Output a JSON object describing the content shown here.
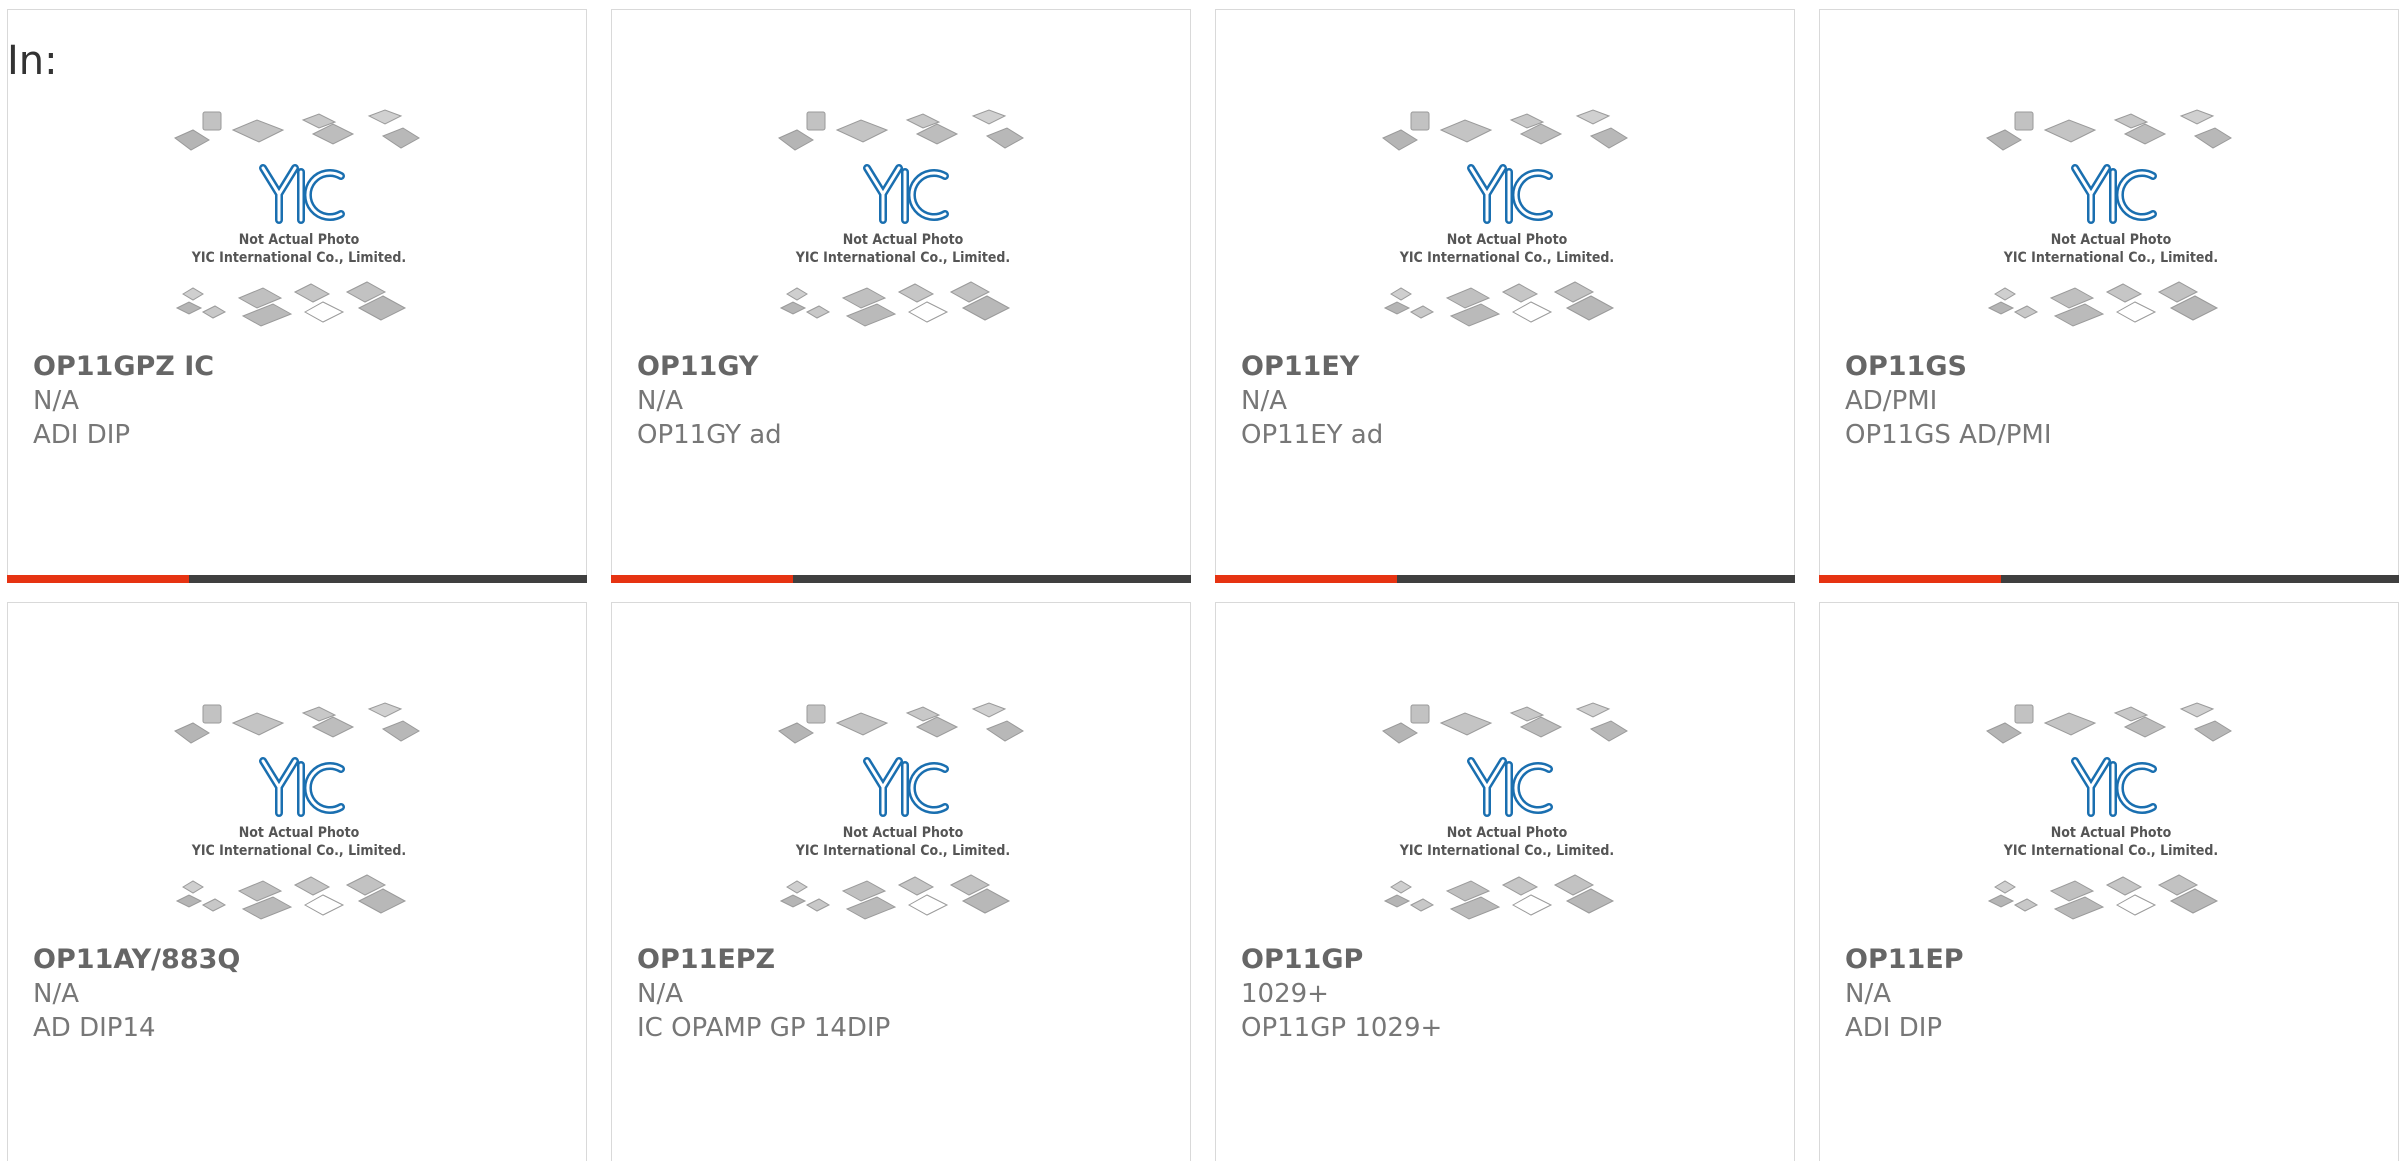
{
  "header": {
    "label": "In:"
  },
  "colors": {
    "accent": "#e63312",
    "bar": "#3f3f3f",
    "logo": "#1a6fb0"
  },
  "placeholder": {
    "caption_line1": "Not Actual Photo",
    "caption_line2": "YIC International Co., Limited.",
    "logo_text": "YIC"
  },
  "products": [
    {
      "part_number": "OP11GPZ IC",
      "manufacturer": "N/A",
      "description": "ADI DIP"
    },
    {
      "part_number": "OP11GY",
      "manufacturer": "N/A",
      "description": "OP11GY ad"
    },
    {
      "part_number": "OP11EY",
      "manufacturer": "N/A",
      "description": "OP11EY ad"
    },
    {
      "part_number": "OP11GS",
      "manufacturer": "AD/PMI",
      "description": "OP11GS AD/PMI"
    },
    {
      "part_number": "OP11AY/883Q",
      "manufacturer": "N/A",
      "description": "AD DIP14"
    },
    {
      "part_number": "OP11EPZ",
      "manufacturer": "N/A",
      "description": "IC OPAMP GP 14DIP"
    },
    {
      "part_number": "OP11GP",
      "manufacturer": "1029+",
      "description": "OP11GP 1029+"
    },
    {
      "part_number": "OP11EP",
      "manufacturer": "N/A",
      "description": "ADI DIP"
    }
  ]
}
